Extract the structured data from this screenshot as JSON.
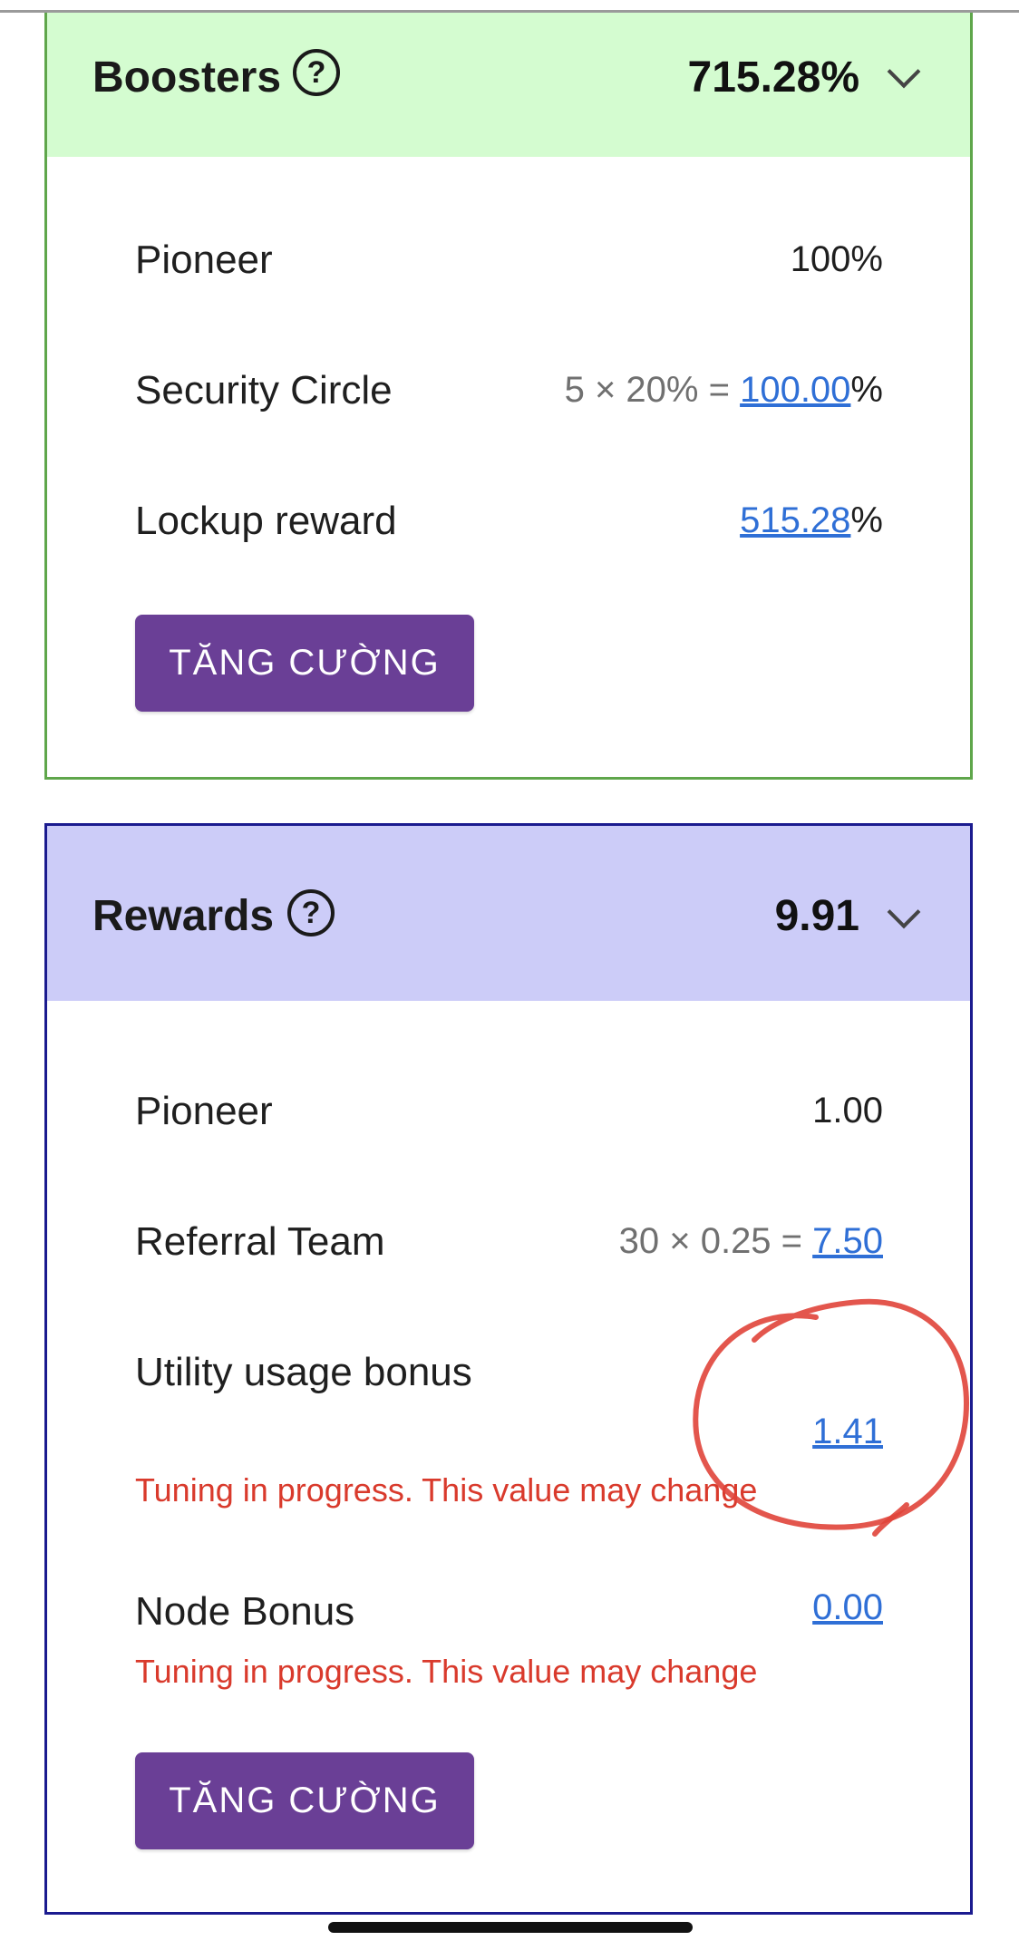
{
  "boosters": {
    "title": "Boosters",
    "help_glyph": "?",
    "total": "715.28%",
    "rows": [
      {
        "label": "Pioneer",
        "value": "100%"
      },
      {
        "label": "Security Circle",
        "formula": "5 × 20% = ",
        "link_value": "100.00",
        "suffix": "%"
      },
      {
        "label": "Lockup reward",
        "link_value": "515.28",
        "suffix": "%"
      }
    ],
    "button_label": "TĂNG CƯỜNG"
  },
  "rewards": {
    "title": "Rewards",
    "help_glyph": "?",
    "total": "9.91",
    "rows": [
      {
        "label": "Pioneer",
        "value": "1.00"
      },
      {
        "label": "Referral Team",
        "formula": "30 × 0.25 = ",
        "link_value": "7.50"
      },
      {
        "label": "Utility usage bonus",
        "link_value": "1.41",
        "warning": "Tuning in progress. This value may change"
      },
      {
        "label": "Node Bonus",
        "link_value": "0.00",
        "warning": "Tuning in progress. This value may change"
      }
    ],
    "button_label": "TĂNG CƯỜNG"
  },
  "colors": {
    "boosters_header": "#d4fcd0",
    "boosters_border": "#5fa64b",
    "rewards_header": "#ccccf8",
    "rewards_border": "#1b1b8f",
    "button": "#6a3f96",
    "link": "#2f6fd6",
    "warning": "#d93a2c",
    "annotation": "#e0443a"
  },
  "icons": [
    "help-icon",
    "chevron-down-icon"
  ]
}
